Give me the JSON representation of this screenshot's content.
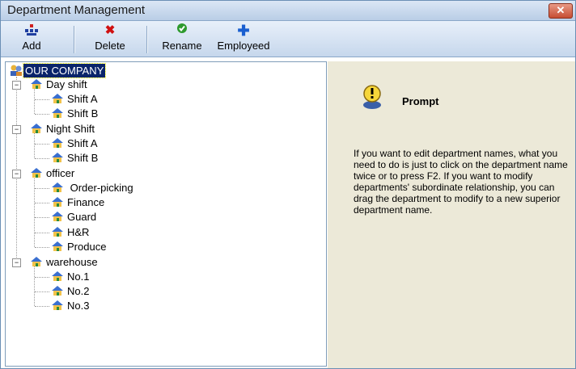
{
  "window": {
    "title": "Department Management",
    "close_glyph": "✕"
  },
  "toolbar": {
    "items": [
      {
        "label": "Add",
        "icon": "add-department-icon"
      },
      {
        "label": "Delete",
        "icon": "delete-x-icon"
      },
      {
        "label": "Rename",
        "icon": "check-icon"
      },
      {
        "label": "Employeed",
        "icon": "plus-icon"
      }
    ]
  },
  "tree": {
    "root": "OUR COMPANY",
    "groups": [
      {
        "label": "Day shift",
        "children": [
          "Shift A",
          "Shift B"
        ]
      },
      {
        "label": "Night Shift",
        "children": [
          "Shift A",
          "Shift B"
        ]
      },
      {
        "label": "officer",
        "children": [
          " Order-picking",
          "Finance",
          "Guard",
          "H&R",
          "Produce"
        ]
      },
      {
        "label": "warehouse",
        "children": [
          "No.1",
          "No.2",
          "No.3"
        ]
      }
    ]
  },
  "prompt": {
    "title": "Prompt",
    "text": "If you want to edit department names, what you need to do is just to click on the department name twice or to press F2. If you want to modify departments' subordinate relationship, you can drag the department to modify to a new superior department name."
  },
  "colors": {
    "selection": "#0a246a",
    "toolbar": "#c6d7ec",
    "prompt_bg": "#ece9d8"
  }
}
